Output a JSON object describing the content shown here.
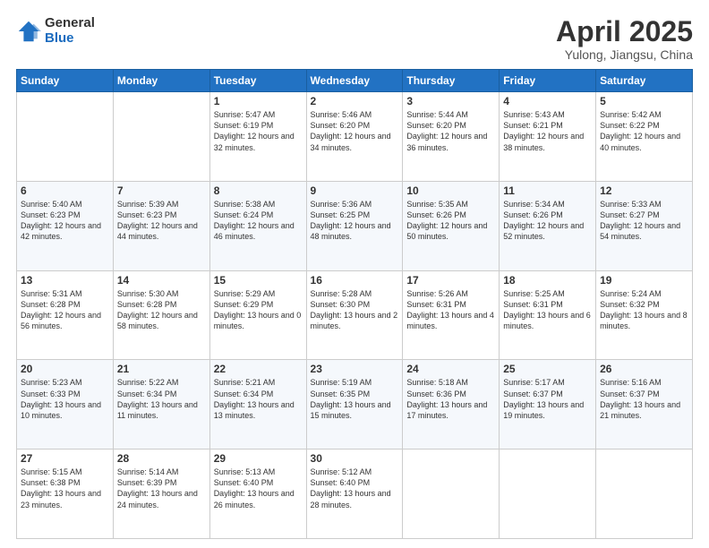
{
  "logo": {
    "general": "General",
    "blue": "Blue"
  },
  "title": {
    "main": "April 2025",
    "sub": "Yulong, Jiangsu, China"
  },
  "weekdays": [
    "Sunday",
    "Monday",
    "Tuesday",
    "Wednesday",
    "Thursday",
    "Friday",
    "Saturday"
  ],
  "weeks": [
    [
      {
        "day": "",
        "info": ""
      },
      {
        "day": "",
        "info": ""
      },
      {
        "day": "1",
        "info": "Sunrise: 5:47 AM\nSunset: 6:19 PM\nDaylight: 12 hours and 32 minutes."
      },
      {
        "day": "2",
        "info": "Sunrise: 5:46 AM\nSunset: 6:20 PM\nDaylight: 12 hours and 34 minutes."
      },
      {
        "day": "3",
        "info": "Sunrise: 5:44 AM\nSunset: 6:20 PM\nDaylight: 12 hours and 36 minutes."
      },
      {
        "day": "4",
        "info": "Sunrise: 5:43 AM\nSunset: 6:21 PM\nDaylight: 12 hours and 38 minutes."
      },
      {
        "day": "5",
        "info": "Sunrise: 5:42 AM\nSunset: 6:22 PM\nDaylight: 12 hours and 40 minutes."
      }
    ],
    [
      {
        "day": "6",
        "info": "Sunrise: 5:40 AM\nSunset: 6:23 PM\nDaylight: 12 hours and 42 minutes."
      },
      {
        "day": "7",
        "info": "Sunrise: 5:39 AM\nSunset: 6:23 PM\nDaylight: 12 hours and 44 minutes."
      },
      {
        "day": "8",
        "info": "Sunrise: 5:38 AM\nSunset: 6:24 PM\nDaylight: 12 hours and 46 minutes."
      },
      {
        "day": "9",
        "info": "Sunrise: 5:36 AM\nSunset: 6:25 PM\nDaylight: 12 hours and 48 minutes."
      },
      {
        "day": "10",
        "info": "Sunrise: 5:35 AM\nSunset: 6:26 PM\nDaylight: 12 hours and 50 minutes."
      },
      {
        "day": "11",
        "info": "Sunrise: 5:34 AM\nSunset: 6:26 PM\nDaylight: 12 hours and 52 minutes."
      },
      {
        "day": "12",
        "info": "Sunrise: 5:33 AM\nSunset: 6:27 PM\nDaylight: 12 hours and 54 minutes."
      }
    ],
    [
      {
        "day": "13",
        "info": "Sunrise: 5:31 AM\nSunset: 6:28 PM\nDaylight: 12 hours and 56 minutes."
      },
      {
        "day": "14",
        "info": "Sunrise: 5:30 AM\nSunset: 6:28 PM\nDaylight: 12 hours and 58 minutes."
      },
      {
        "day": "15",
        "info": "Sunrise: 5:29 AM\nSunset: 6:29 PM\nDaylight: 13 hours and 0 minutes."
      },
      {
        "day": "16",
        "info": "Sunrise: 5:28 AM\nSunset: 6:30 PM\nDaylight: 13 hours and 2 minutes."
      },
      {
        "day": "17",
        "info": "Sunrise: 5:26 AM\nSunset: 6:31 PM\nDaylight: 13 hours and 4 minutes."
      },
      {
        "day": "18",
        "info": "Sunrise: 5:25 AM\nSunset: 6:31 PM\nDaylight: 13 hours and 6 minutes."
      },
      {
        "day": "19",
        "info": "Sunrise: 5:24 AM\nSunset: 6:32 PM\nDaylight: 13 hours and 8 minutes."
      }
    ],
    [
      {
        "day": "20",
        "info": "Sunrise: 5:23 AM\nSunset: 6:33 PM\nDaylight: 13 hours and 10 minutes."
      },
      {
        "day": "21",
        "info": "Sunrise: 5:22 AM\nSunset: 6:34 PM\nDaylight: 13 hours and 11 minutes."
      },
      {
        "day": "22",
        "info": "Sunrise: 5:21 AM\nSunset: 6:34 PM\nDaylight: 13 hours and 13 minutes."
      },
      {
        "day": "23",
        "info": "Sunrise: 5:19 AM\nSunset: 6:35 PM\nDaylight: 13 hours and 15 minutes."
      },
      {
        "day": "24",
        "info": "Sunrise: 5:18 AM\nSunset: 6:36 PM\nDaylight: 13 hours and 17 minutes."
      },
      {
        "day": "25",
        "info": "Sunrise: 5:17 AM\nSunset: 6:37 PM\nDaylight: 13 hours and 19 minutes."
      },
      {
        "day": "26",
        "info": "Sunrise: 5:16 AM\nSunset: 6:37 PM\nDaylight: 13 hours and 21 minutes."
      }
    ],
    [
      {
        "day": "27",
        "info": "Sunrise: 5:15 AM\nSunset: 6:38 PM\nDaylight: 13 hours and 23 minutes."
      },
      {
        "day": "28",
        "info": "Sunrise: 5:14 AM\nSunset: 6:39 PM\nDaylight: 13 hours and 24 minutes."
      },
      {
        "day": "29",
        "info": "Sunrise: 5:13 AM\nSunset: 6:40 PM\nDaylight: 13 hours and 26 minutes."
      },
      {
        "day": "30",
        "info": "Sunrise: 5:12 AM\nSunset: 6:40 PM\nDaylight: 13 hours and 28 minutes."
      },
      {
        "day": "",
        "info": ""
      },
      {
        "day": "",
        "info": ""
      },
      {
        "day": "",
        "info": ""
      }
    ]
  ]
}
